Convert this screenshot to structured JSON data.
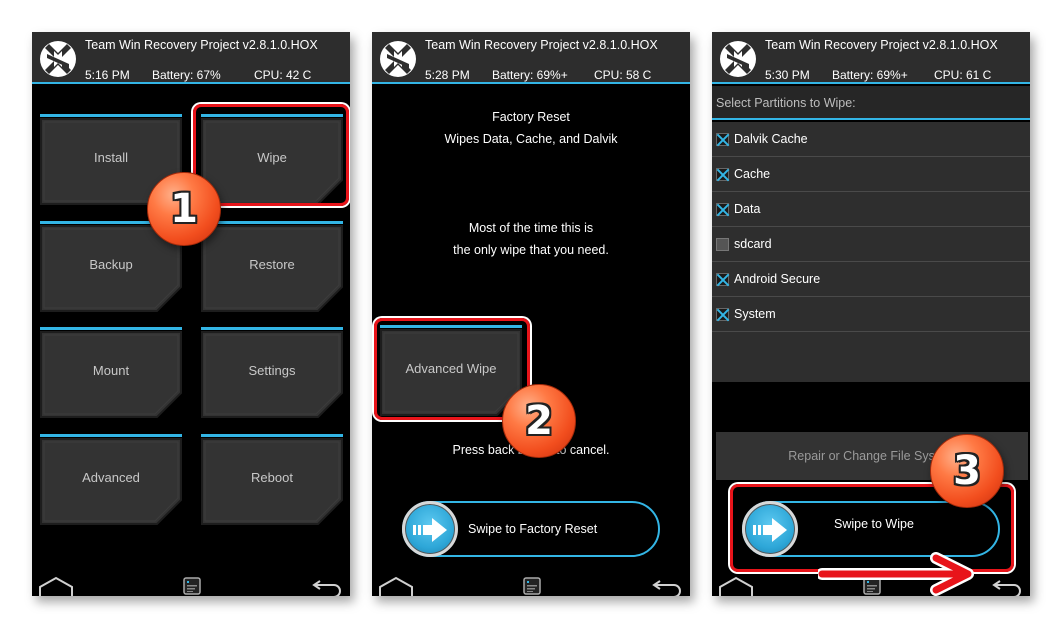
{
  "app": {
    "title": "Team Win Recovery Project  v2.8.1.0.HOX"
  },
  "colors": {
    "accent": "#33b5e5",
    "header_bg": "#2d2d2d",
    "tile_bg": "#333333",
    "highlight": "#e8141a",
    "badge": "#f24e1e"
  },
  "screens": [
    {
      "status": {
        "time": "5:16 PM",
        "battery": "Battery: 67%",
        "cpu": "CPU: 42 C"
      },
      "menu": [
        {
          "label": "Install"
        },
        {
          "label": "Wipe"
        },
        {
          "label": "Backup"
        },
        {
          "label": "Restore"
        },
        {
          "label": "Mount"
        },
        {
          "label": "Settings"
        },
        {
          "label": "Advanced"
        },
        {
          "label": "Reboot"
        }
      ],
      "step_badge": "1"
    },
    {
      "status": {
        "time": "5:28 PM",
        "battery": "Battery: 69%+",
        "cpu": "CPU: 58 C"
      },
      "title": "Factory Reset",
      "subtitle": "Wipes Data, Cache, and Dalvik",
      "note_line1": "Most of the time this is",
      "note_line2": "the only wipe that you need.",
      "advanced_wipe_label": "Advanced Wipe",
      "cancel_hint": "Press back button to cancel.",
      "swipe_label": "Swipe to Factory Reset",
      "step_badge": "2"
    },
    {
      "status": {
        "time": "5:30 PM",
        "battery": "Battery: 69%+",
        "cpu": "CPU: 61 C"
      },
      "partitions_header": "Select Partitions to Wipe:",
      "partitions": [
        {
          "label": "Dalvik Cache",
          "checked": true
        },
        {
          "label": "Cache",
          "checked": true
        },
        {
          "label": "Data",
          "checked": true
        },
        {
          "label": "sdcard",
          "checked": false
        },
        {
          "label": "Android Secure",
          "checked": true
        },
        {
          "label": "System",
          "checked": true
        }
      ],
      "repair_label": "Repair or Change File System",
      "swipe_label": "Swipe to Wipe",
      "step_badge": "3"
    }
  ]
}
